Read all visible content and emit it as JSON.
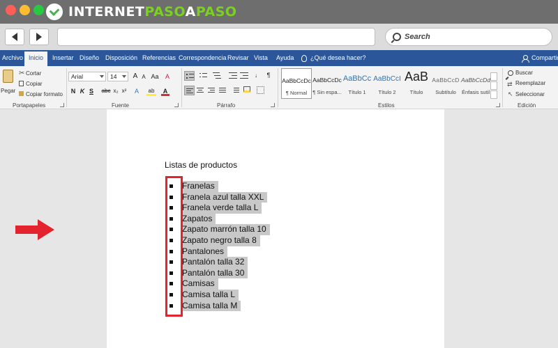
{
  "browser": {
    "brand": {
      "part1": "INTERNET",
      "part2": "PASO",
      "part3": "A",
      "part4": "PASO"
    },
    "search_label": "Search",
    "dots": [
      "#ff5f57",
      "#febc2e",
      "#28c840"
    ]
  },
  "ribbon_tabs": [
    "Archivo",
    "Inicio",
    "Insertar",
    "Diseño",
    "Disposición",
    "Referencias",
    "Correspondencia",
    "Revisar",
    "Vista",
    "Ayuda"
  ],
  "tell_me": "¿Qué desea hacer?",
  "share": "Compartir",
  "clipboard": {
    "paste": "Pegar",
    "cut": "Cortar",
    "copy": "Copiar",
    "format_painter": "Copiar formato",
    "group": "Portapapeles"
  },
  "font": {
    "name": "Arial",
    "size": "14",
    "group": "Fuente",
    "bold": "N",
    "italic": "K",
    "underline": "S",
    "strike": "abc",
    "sub": "x₂",
    "sup": "x²",
    "grow": "A",
    "shrink": "A",
    "case": "Aa",
    "clear": "A",
    "effects": "A",
    "highlight": "ab",
    "color": "A"
  },
  "paragraph": {
    "group": "Párrafo",
    "pilcrow": "¶"
  },
  "styles": {
    "group": "Estilos",
    "items": [
      {
        "preview": "AaBbCcDc",
        "name": "¶ Normal"
      },
      {
        "preview": "AaBbCcDc",
        "name": "¶ Sin espa..."
      },
      {
        "preview": "AaBbCc",
        "name": "Título 1"
      },
      {
        "preview": "AaBbCcI",
        "name": "Título 2"
      },
      {
        "preview": "AaB",
        "name": "Título"
      },
      {
        "preview": "AaBbCcD",
        "name": "Subtítulo"
      },
      {
        "preview": "AaBbCcDd",
        "name": "Énfasis sutil"
      }
    ]
  },
  "editing": {
    "group": "Edición",
    "find": "Buscar",
    "replace": "Reemplazar",
    "select": "Seleccionar"
  },
  "document": {
    "heading": "Listas de productos",
    "items": [
      "Franelas",
      "Franela azul talla XXL",
      "Franela verde talla L",
      "Zapatos",
      "Zapato marrón talla 10",
      "Zapato negro talla 8",
      "Pantalones",
      "Pantalón talla 32",
      "Pantalón talla 30",
      "Camisas",
      "Camisa talla L",
      "Camisa talla M"
    ]
  },
  "colors": {
    "word_blue": "#2b579a",
    "annotation_red": "#e3232d",
    "brand_green": "#7bd11f"
  }
}
